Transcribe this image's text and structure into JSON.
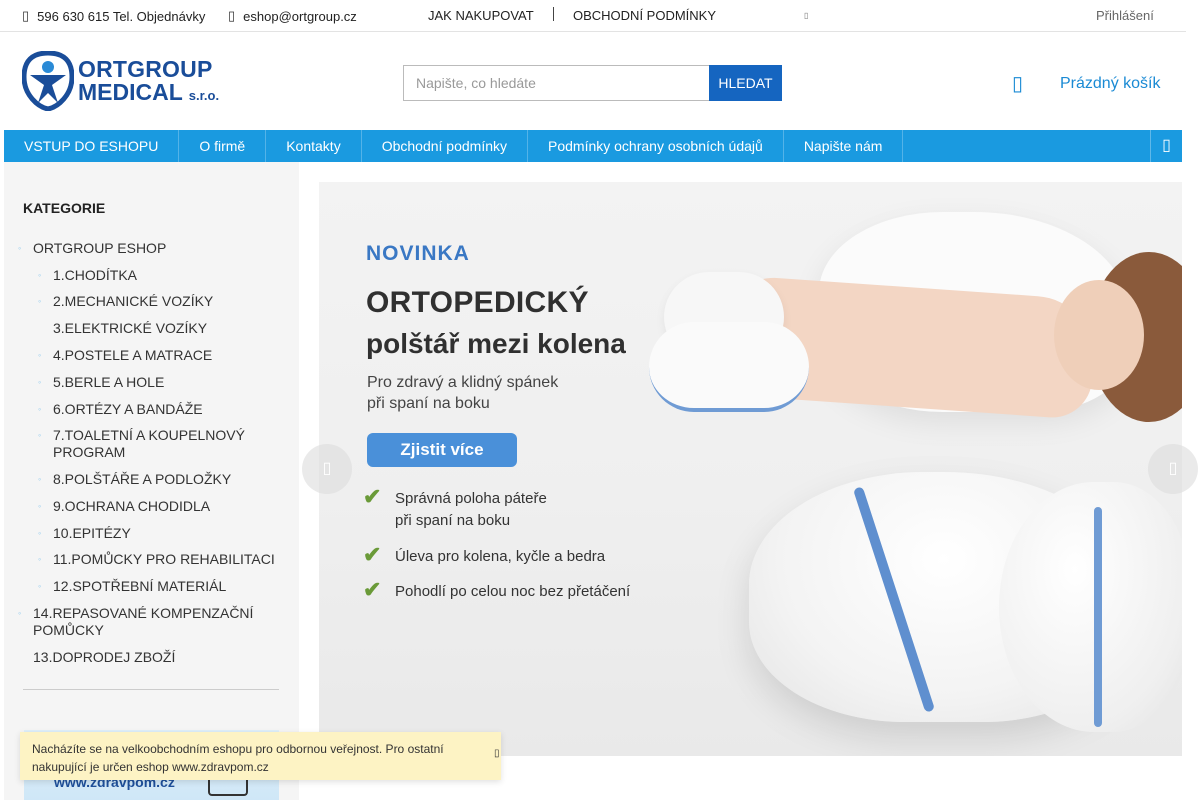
{
  "topbar": {
    "phone_icon": "phone-icon",
    "phone": "596 630 615 Tel. Objednávky",
    "email_icon": "mail-icon",
    "email": "eshop@ortgroup.cz",
    "nav1": "JAK NAKUPOVAT",
    "nav2": "OBCHODNÍ PODMÍNKY",
    "login": "Přihlášení"
  },
  "logo": {
    "line1": "ORTGROUP",
    "line2": "MEDICAL",
    "line2_suffix": "s.r.o."
  },
  "search": {
    "placeholder": "Napište, co hledáte",
    "button": "HLEDAT"
  },
  "cart": {
    "label": "Prázdný košík",
    "icon": "cart-icon"
  },
  "menu": {
    "items": [
      "VSTUP DO ESHOPU",
      "O firmě",
      "Kontakty",
      "Obchodní podmínky",
      "Podmínky ochrany osobních údajů",
      "Napište nám"
    ],
    "burger_icon": "menu-icon",
    "bg": "#1a9ae0"
  },
  "sidebar": {
    "title": "KATEGORIE",
    "categories": [
      "ORTGROUP ESHOP",
      "1.CHODÍTKA",
      "2.MECHANICKÉ VOZÍKY",
      "3.ELEKTRICKÉ VOZÍKY",
      "4.POSTELE A MATRACE",
      "5.BERLE A HOLE",
      "6.ORTÉZY A BANDÁŽE",
      "7.TOALETNÍ A KOUPELNOVÝ PROGRAM",
      "8.POLŠTÁŘE A PODLOŽKY",
      "9.OCHRANA CHODIDLA",
      "10.EPITÉZY",
      "11.POMŮCKY PRO REHABILITACI",
      "12.SPOTŘEBNÍ MATERIÁL",
      "14.REPASOVANÉ KOMPENZAČNÍ POMŮCKY",
      "13.DOPRODEJ ZBOŽÍ"
    ],
    "banner_text": "www.zdravpom.cz"
  },
  "hero": {
    "badge": "NOVINKA",
    "title1": "ORTOPEDICKÝ",
    "title2": "polštář mezi kolena",
    "sub1": "Pro zdravý a klidný spánek",
    "sub2": "při spaní na boku",
    "cta": "Zjistit více",
    "features": [
      "Správná poloha páteře",
      "při spaní na boku",
      "Úleva pro kolena, kyčle a bedra",
      "Pohodlí po celou noc bez přetáčení"
    ],
    "accent": "#3a78c4"
  },
  "notice": {
    "text": "Nacházíte se na velkoobchodním eshopu pro odbornou veřejnost. Pro ostatní nakupující je určen eshop www.zdravpom.cz",
    "close_icon": "close-icon",
    "bg": "#fdf3c4"
  }
}
